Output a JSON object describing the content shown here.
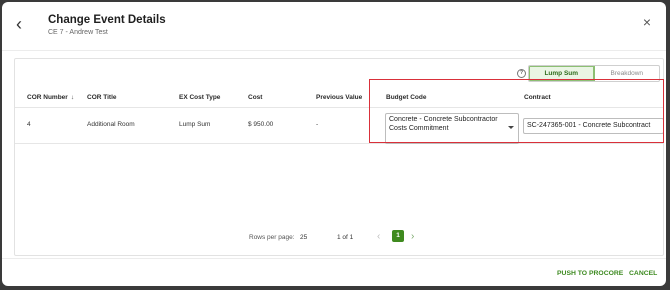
{
  "header": {
    "back_glyph": "‹",
    "title": "Change Event Details",
    "subtitle": "CE 7 - Andrew Test",
    "close_glyph": "×"
  },
  "view_toggle": {
    "options": [
      "Lump Sum",
      "Breakdown"
    ],
    "selected": "Lump Sum",
    "help_glyph": "?"
  },
  "table": {
    "columns": [
      "COR Number",
      "COR Title",
      "EX Cost Type",
      "Cost",
      "Previous Value",
      "Budget Code",
      "Contract"
    ],
    "sort_glyph": "↓",
    "rows": [
      {
        "cor_number": "4",
        "cor_title": "Additional Room",
        "ex_cost_type": "Lump Sum",
        "cost": "$ 950.00",
        "previous_value": "-",
        "budget_code": "Concrete - Concrete Subcontractor Costs Commitment",
        "contract": "SC-247365-001 - Concrete Subcontract"
      }
    ]
  },
  "pagination": {
    "rows_per_page_label": "Rows per page:",
    "rows_per_page": "25",
    "range": "1 of 1",
    "current_page": "1",
    "prev_glyph": "‹",
    "next_glyph": "›"
  },
  "footer": {
    "push_label": "PUSH TO PROCORE",
    "cancel_label": "CANCEL"
  },
  "colors": {
    "accent_green": "#3f8a1f",
    "highlight_red": "#d9303a"
  }
}
